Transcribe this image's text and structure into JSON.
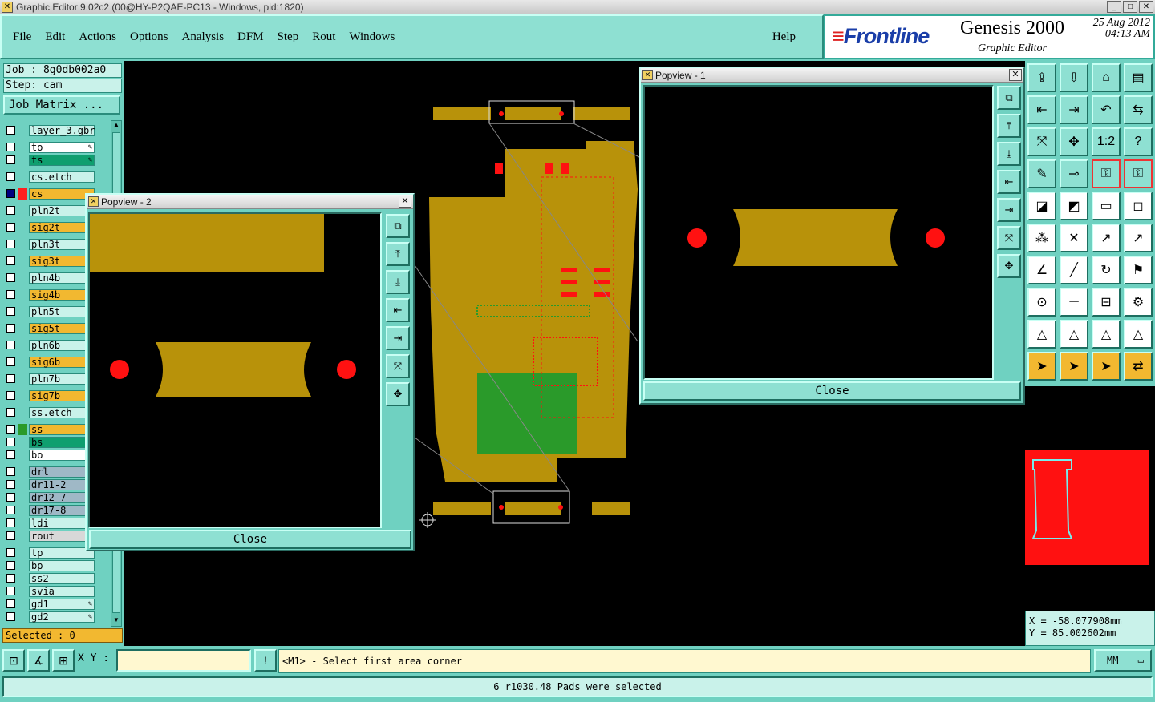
{
  "window": {
    "title": "Graphic Editor 9.02c2 (00@HY-P2QAE-PC13 - Windows, pid:1820)",
    "min": "_",
    "max": "□",
    "close": "✕"
  },
  "menu": {
    "items": [
      "File",
      "Edit",
      "Actions",
      "Options",
      "Analysis",
      "DFM",
      "Step",
      "Rout",
      "Windows"
    ],
    "help": "Help"
  },
  "brand": {
    "logo": "Frontline",
    "product": "Genesis 2000",
    "date": "25 Aug 2012",
    "time": "04:13 AM",
    "subtitle": "Graphic Editor"
  },
  "job": {
    "job": "Job : 8g0db002a0",
    "step": "Step: cam",
    "matrix_button": "Job Matrix ..."
  },
  "layers": [
    {
      "name": "layer_3.gbr",
      "color": "#c9f2ea",
      "box": "",
      "checked": false,
      "edit": false
    },
    {
      "name": "to",
      "color": "#ffffff",
      "box": "",
      "checked": false,
      "edit": true
    },
    {
      "name": "ts",
      "color": "#0f9f6f",
      "box": "",
      "checked": false,
      "edit": true
    },
    {
      "name": "cs.etch",
      "color": "#c9f2ea",
      "box": "",
      "checked": false,
      "edit": false
    },
    {
      "name": "cs",
      "color": "#f2b830",
      "box": "#ff2020",
      "checked": true,
      "edit": false
    },
    {
      "name": "pln2t",
      "color": "#c9f2ea",
      "box": "",
      "checked": false,
      "edit": false
    },
    {
      "name": "sig2t",
      "color": "#f2b830",
      "box": "",
      "checked": false,
      "edit": false
    },
    {
      "name": "pln3t",
      "color": "#c9f2ea",
      "box": "",
      "checked": false,
      "edit": false
    },
    {
      "name": "sig3t",
      "color": "#f2b830",
      "box": "",
      "checked": false,
      "edit": false
    },
    {
      "name": "pln4b",
      "color": "#c9f2ea",
      "box": "",
      "checked": false,
      "edit": false
    },
    {
      "name": "sig4b",
      "color": "#f2b830",
      "box": "",
      "checked": false,
      "edit": false
    },
    {
      "name": "pln5t",
      "color": "#c9f2ea",
      "box": "",
      "checked": false,
      "edit": false
    },
    {
      "name": "sig5t",
      "color": "#f2b830",
      "box": "",
      "checked": false,
      "edit": false
    },
    {
      "name": "pln6b",
      "color": "#c9f2ea",
      "box": "",
      "checked": false,
      "edit": false
    },
    {
      "name": "sig6b",
      "color": "#f2b830",
      "box": "",
      "checked": false,
      "edit": false
    },
    {
      "name": "pln7b",
      "color": "#c9f2ea",
      "box": "",
      "checked": false,
      "edit": false
    },
    {
      "name": "sig7b",
      "color": "#f2b830",
      "box": "",
      "checked": false,
      "edit": false
    },
    {
      "name": "ss.etch",
      "color": "#c9f2ea",
      "box": "",
      "checked": false,
      "edit": false
    },
    {
      "name": "ss",
      "color": "#f2b830",
      "box": "#2a9a2a",
      "checked": false,
      "edit": false
    },
    {
      "name": "bs",
      "color": "#0f9f6f",
      "box": "",
      "checked": false,
      "edit": false
    },
    {
      "name": "bo",
      "color": "#ffffff",
      "box": "",
      "checked": false,
      "edit": false
    },
    {
      "name": "drl",
      "color": "#9fb8c6",
      "box": "",
      "checked": false,
      "edit": false
    },
    {
      "name": "dr11-2",
      "color": "#9fb8c6",
      "box": "",
      "checked": false,
      "edit": false
    },
    {
      "name": "dr12-7",
      "color": "#9fb8c6",
      "box": "",
      "checked": false,
      "edit": false
    },
    {
      "name": "dr17-8",
      "color": "#9fb8c6",
      "box": "",
      "checked": false,
      "edit": false
    },
    {
      "name": "ldi",
      "color": "#c9f2ea",
      "box": "",
      "checked": false,
      "edit": false
    },
    {
      "name": "rout",
      "color": "#d8d8d8",
      "box": "",
      "checked": false,
      "edit": false
    },
    {
      "name": "tp",
      "color": "#c9f2ea",
      "box": "",
      "checked": false,
      "edit": false
    },
    {
      "name": "bp",
      "color": "#c9f2ea",
      "box": "",
      "checked": false,
      "edit": false
    },
    {
      "name": "ss2",
      "color": "#c9f2ea",
      "box": "",
      "checked": false,
      "edit": false
    },
    {
      "name": "svia",
      "color": "#c9f2ea",
      "box": "",
      "checked": false,
      "edit": false
    },
    {
      "name": "gd1",
      "color": "#c9f2ea",
      "box": "",
      "checked": false,
      "edit": true
    },
    {
      "name": "gd2",
      "color": "#c9f2ea",
      "box": "",
      "checked": false,
      "edit": true
    }
  ],
  "selected": "Selected : 0",
  "popview1": {
    "title": "Popview - 1",
    "close": "Close"
  },
  "popview2": {
    "title": "Popview - 2",
    "close": "Close"
  },
  "coords": {
    "x": "X = -58.077908mm",
    "y": "Y = 85.002602mm"
  },
  "bottom": {
    "xy_label": "X Y :",
    "xy_value": "",
    "prompt": "<M1> - Select first area corner",
    "units": "MM",
    "units_icon": "▭",
    "status": "6 r1030.48 Pads were selected",
    "warn": "!"
  },
  "colors": {
    "copper": "#b8920a",
    "pad": "#ff1010",
    "mask": "#2a9a2a",
    "panel": "#6fd1c1"
  },
  "icons": {
    "tools": [
      "open-icon",
      "save-icon",
      "home-icon",
      "window-icon",
      "import-icon",
      "export-icon",
      "undo-icon",
      "redo-icon",
      "zoom-fit-icon",
      "zoom-home-icon",
      "scale-icon",
      "help-icon",
      "pen-icon",
      "measure-icon",
      "snap-icon",
      "snap2-icon",
      "select-icon",
      "red-pen-icon",
      "ruler-icon",
      "dotbox-icon",
      "nodes-icon",
      "cross-icon",
      "arrow-icon",
      "arrow2-icon",
      "angle-icon",
      "slash-icon",
      "arc-icon",
      "flag-icon",
      "dot-icon",
      "dash-icon",
      "gauge-icon",
      "gear-icon",
      "tri-icon",
      "tri2-icon",
      "tri3-icon",
      "tri4-icon",
      "cursor-icon",
      "cursor2-icon",
      "cursor3-icon",
      "connect-icon"
    ]
  }
}
